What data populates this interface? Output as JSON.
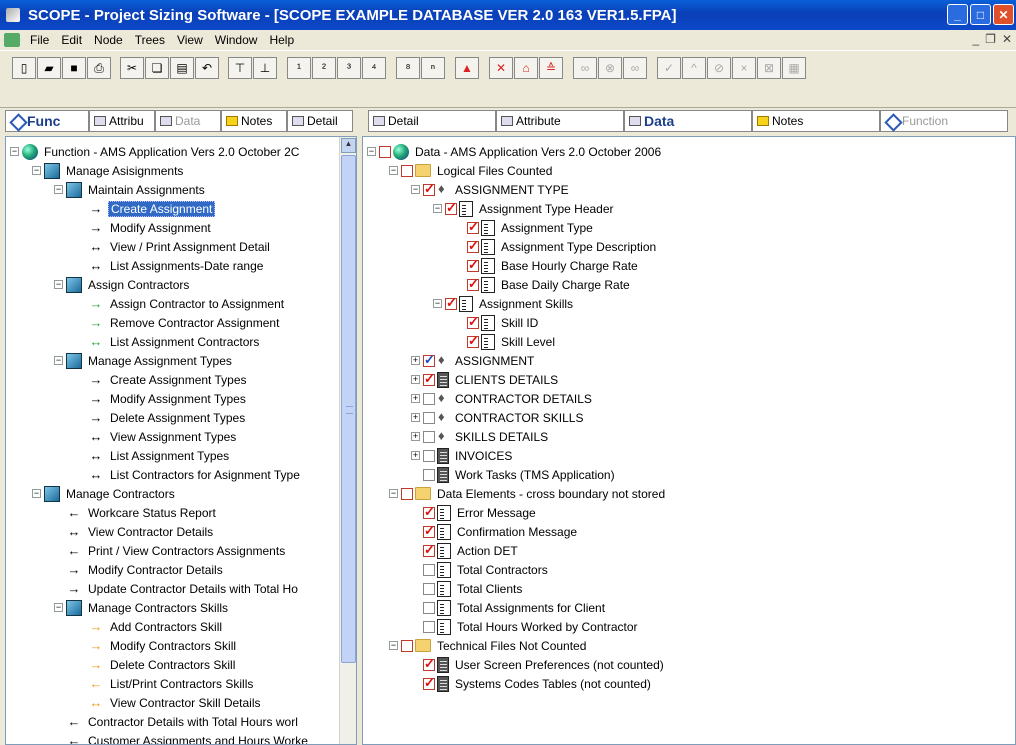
{
  "window": {
    "title": "SCOPE - Project Sizing Software  - [SCOPE EXAMPLE DATABASE VER 2.0 163 VER1.5.FPA]"
  },
  "menu": [
    "File",
    "Edit",
    "Node",
    "Trees",
    "View",
    "Window",
    "Help"
  ],
  "left_tabs": [
    {
      "label": "Func",
      "state": "active",
      "icon": "function-icon"
    },
    {
      "label": "Attribu",
      "state": "normal",
      "icon": "attribute-icon"
    },
    {
      "label": "Data",
      "state": "dim",
      "icon": "data-icon"
    },
    {
      "label": "Notes",
      "state": "normal",
      "icon": "notes-icon"
    },
    {
      "label": "Detail",
      "state": "normal",
      "icon": "detail-icon"
    }
  ],
  "right_tabs": [
    {
      "label": "Detail",
      "state": "normal",
      "icon": "detail-icon"
    },
    {
      "label": "Attribute",
      "state": "normal",
      "icon": "attribute-icon"
    },
    {
      "label": "Data",
      "state": "active",
      "icon": "data-icon"
    },
    {
      "label": "Notes",
      "state": "normal",
      "icon": "notes-icon"
    },
    {
      "label": "Function",
      "state": "dim",
      "icon": "function-icon"
    }
  ],
  "function_tree": [
    {
      "level": 0,
      "exp": "-",
      "icon": "globe",
      "text": "Function - AMS Application  Vers 2.0 October 2C"
    },
    {
      "level": 1,
      "exp": "-",
      "icon": "cube",
      "text": "Manage Asisignments"
    },
    {
      "level": 2,
      "exp": "-",
      "icon": "cube",
      "text": "Maintain Assignments"
    },
    {
      "level": 3,
      "arrow": "→",
      "color": "black",
      "text": "Create Assignment",
      "selected": true
    },
    {
      "level": 3,
      "arrow": "→",
      "color": "black",
      "text": "Modify Assignment"
    },
    {
      "level": 3,
      "arrow": "↔",
      "color": "black",
      "text": "View / Print Assignment Detail"
    },
    {
      "level": 3,
      "arrow": "↔",
      "color": "black",
      "text": "List Assignments-Date range"
    },
    {
      "level": 2,
      "exp": "-",
      "icon": "cube",
      "text": "Assign Contractors"
    },
    {
      "level": 3,
      "arrow": "→",
      "color": "green",
      "text": "Assign Contractor to Assignment"
    },
    {
      "level": 3,
      "arrow": "→",
      "color": "green",
      "text": "Remove Contractor  Assignment"
    },
    {
      "level": 3,
      "arrow": "↔",
      "color": "green",
      "text": "List Assignment Contractors"
    },
    {
      "level": 2,
      "exp": "-",
      "icon": "cube",
      "text": "Manage Assignment Types"
    },
    {
      "level": 3,
      "arrow": "→",
      "color": "black",
      "text": "Create Assignment Types"
    },
    {
      "level": 3,
      "arrow": "→",
      "color": "black",
      "text": "Modify Assignment Types"
    },
    {
      "level": 3,
      "arrow": "→",
      "color": "black",
      "text": "Delete Assignment Types"
    },
    {
      "level": 3,
      "arrow": "↔",
      "color": "black",
      "text": "View Assignment Types"
    },
    {
      "level": 3,
      "arrow": "↔",
      "color": "black",
      "text": "List Assignment Types"
    },
    {
      "level": 3,
      "arrow": "↔",
      "color": "black",
      "text": "List Contractors for Asignment Type"
    },
    {
      "level": 1,
      "exp": "-",
      "icon": "cube",
      "text": "Manage Contractors"
    },
    {
      "level": 2,
      "arrow": "←",
      "color": "black",
      "text": "Workcare Status Report"
    },
    {
      "level": 2,
      "arrow": "↔",
      "color": "black",
      "text": "View Contractor Details"
    },
    {
      "level": 2,
      "arrow": "←",
      "color": "black",
      "text": "Print / View Contractors Assignments"
    },
    {
      "level": 2,
      "arrow": "→",
      "color": "black",
      "text": "Modify Contractor Details"
    },
    {
      "level": 2,
      "arrow": "→",
      "color": "black",
      "text": "Update Contractor Details with Total Ho"
    },
    {
      "level": 2,
      "exp": "-",
      "icon": "cube",
      "text": "Manage Contractors Skills"
    },
    {
      "level": 3,
      "arrow": "→",
      "color": "orange",
      "text": "Add Contractors Skill"
    },
    {
      "level": 3,
      "arrow": "→",
      "color": "orange",
      "text": "Modify Contractors Skill"
    },
    {
      "level": 3,
      "arrow": "→",
      "color": "orange",
      "text": "Delete Contractors Skill"
    },
    {
      "level": 3,
      "arrow": "←",
      "color": "orange",
      "text": "List/Print Contractors Skills"
    },
    {
      "level": 3,
      "arrow": "↔",
      "color": "orange",
      "text": "View Contractor Skill Details"
    },
    {
      "level": 2,
      "arrow": "←",
      "color": "black",
      "text": "Contractor Details with Total Hours worl"
    },
    {
      "level": 2,
      "arrow": "←",
      "color": "black",
      "text": "Customer Assignments and Hours Worke"
    }
  ],
  "data_tree": [
    {
      "level": 0,
      "exp": "-",
      "cb": "red",
      "checked": false,
      "icon": "globe",
      "text": "Data - AMS Application  Vers 2.0 October 2006"
    },
    {
      "level": 1,
      "exp": "-",
      "cb": "red",
      "checked": false,
      "icon": "folder",
      "text": "Logical Files Counted"
    },
    {
      "level": 2,
      "exp": "-",
      "cb": "red",
      "checked": true,
      "icon": "pen",
      "text": "ASSIGNMENT TYPE"
    },
    {
      "level": 3,
      "exp": "-",
      "cb": "red",
      "checked": true,
      "icon": "form",
      "text": "Assignment Type Header"
    },
    {
      "level": 4,
      "cb": "red",
      "checked": true,
      "icon": "form",
      "text": "Assignment Type"
    },
    {
      "level": 4,
      "cb": "red",
      "checked": true,
      "icon": "form",
      "text": "Assignment Type Description"
    },
    {
      "level": 4,
      "cb": "red",
      "checked": true,
      "icon": "form",
      "text": "Base Hourly Charge Rate"
    },
    {
      "level": 4,
      "cb": "red",
      "checked": true,
      "icon": "form",
      "text": "Base Daily Charge Rate"
    },
    {
      "level": 3,
      "exp": "-",
      "cb": "red",
      "checked": true,
      "icon": "form",
      "text": "Assignment Skills"
    },
    {
      "level": 4,
      "cb": "red",
      "checked": true,
      "icon": "form",
      "text": "Skill ID"
    },
    {
      "level": 4,
      "cb": "red",
      "checked": true,
      "icon": "form",
      "text": "Skill Level"
    },
    {
      "level": 2,
      "exp": "+",
      "cb": "blue",
      "checked": true,
      "icon": "pen",
      "text": "ASSIGNMENT"
    },
    {
      "level": 2,
      "exp": "+",
      "cb": "red",
      "checked": true,
      "icon": "doc",
      "text": "CLIENTS  DETAILS"
    },
    {
      "level": 2,
      "exp": "+",
      "cb": "blank",
      "checked": false,
      "icon": "pen",
      "text": "CONTRACTOR DETAILS"
    },
    {
      "level": 2,
      "exp": "+",
      "cb": "blank",
      "checked": false,
      "icon": "pen",
      "text": "CONTRACTOR SKILLS"
    },
    {
      "level": 2,
      "exp": "+",
      "cb": "blank",
      "checked": false,
      "icon": "pen",
      "text": "SKILLS DETAILS"
    },
    {
      "level": 2,
      "exp": "+",
      "cb": "blank",
      "checked": false,
      "icon": "doc",
      "text": "INVOICES"
    },
    {
      "level": 2,
      "cb": "blank",
      "checked": false,
      "icon": "doc",
      "text": "Work Tasks (TMS Application)"
    },
    {
      "level": 1,
      "exp": "-",
      "cb": "red",
      "checked": false,
      "icon": "folder",
      "text": "Data Elements - cross boundary not stored"
    },
    {
      "level": 2,
      "cb": "red",
      "checked": true,
      "icon": "form",
      "text": "Error Message"
    },
    {
      "level": 2,
      "cb": "red",
      "checked": true,
      "icon": "form",
      "text": "Confirmation Message"
    },
    {
      "level": 2,
      "cb": "red",
      "checked": true,
      "icon": "form",
      "text": "Action DET"
    },
    {
      "level": 2,
      "cb": "blank",
      "checked": false,
      "icon": "form",
      "text": "Total Contractors"
    },
    {
      "level": 2,
      "cb": "blank",
      "checked": false,
      "icon": "form",
      "text": "Total Clients"
    },
    {
      "level": 2,
      "cb": "blank",
      "checked": false,
      "icon": "form",
      "text": "Total Assignments for Client"
    },
    {
      "level": 2,
      "cb": "blank",
      "checked": false,
      "icon": "form",
      "text": "Total Hours Worked by Contractor"
    },
    {
      "level": 1,
      "exp": "-",
      "cb": "red",
      "checked": false,
      "icon": "folder",
      "text": "Technical Files Not Counted"
    },
    {
      "level": 2,
      "cb": "red",
      "checked": true,
      "icon": "doc",
      "text": "User Screen Preferences (not counted)"
    },
    {
      "level": 2,
      "cb": "red",
      "checked": true,
      "icon": "doc",
      "text": "Systems Codes Tables (not counted)"
    }
  ]
}
